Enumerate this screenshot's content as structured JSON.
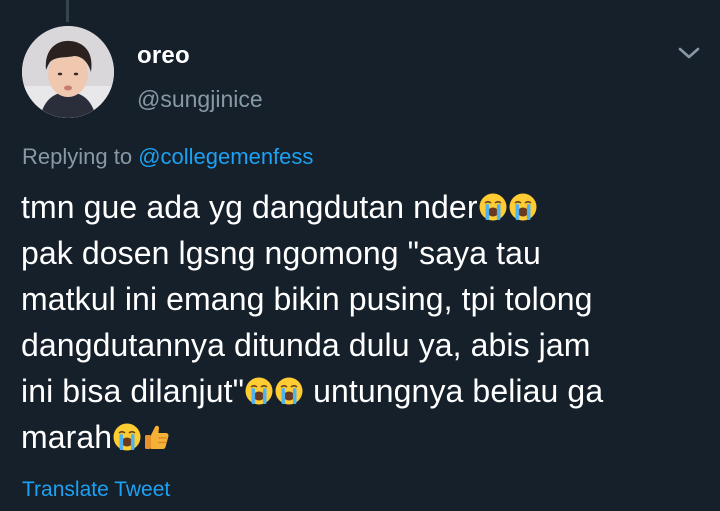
{
  "tweet": {
    "author": {
      "display_name": "oreo",
      "handle": "@sungjinice"
    },
    "replying_prefix": "Replying to",
    "replying_to": "@collegemenfess",
    "text_lines": {
      "l1": "tmn gue ada yg dangdutan nder",
      "l2": "pak dosen lgsng ngomong \"saya tau",
      "l3": "matkul ini emang bikin pusing, tpi tolong",
      "l4": "dangdutannya ditunda dulu ya, abis jam",
      "l5a": "ini bisa dilanjut\"",
      "l5b": " untungnya beliau ga",
      "l6": "marah"
    },
    "emoji_names": [
      "loudly-crying-face",
      "thumbs-up"
    ],
    "translate_label": "Translate Tweet"
  },
  "colors": {
    "background": "#15202b",
    "text_primary": "#ffffff",
    "text_secondary": "#8899a6",
    "accent": "#1da1f2"
  }
}
